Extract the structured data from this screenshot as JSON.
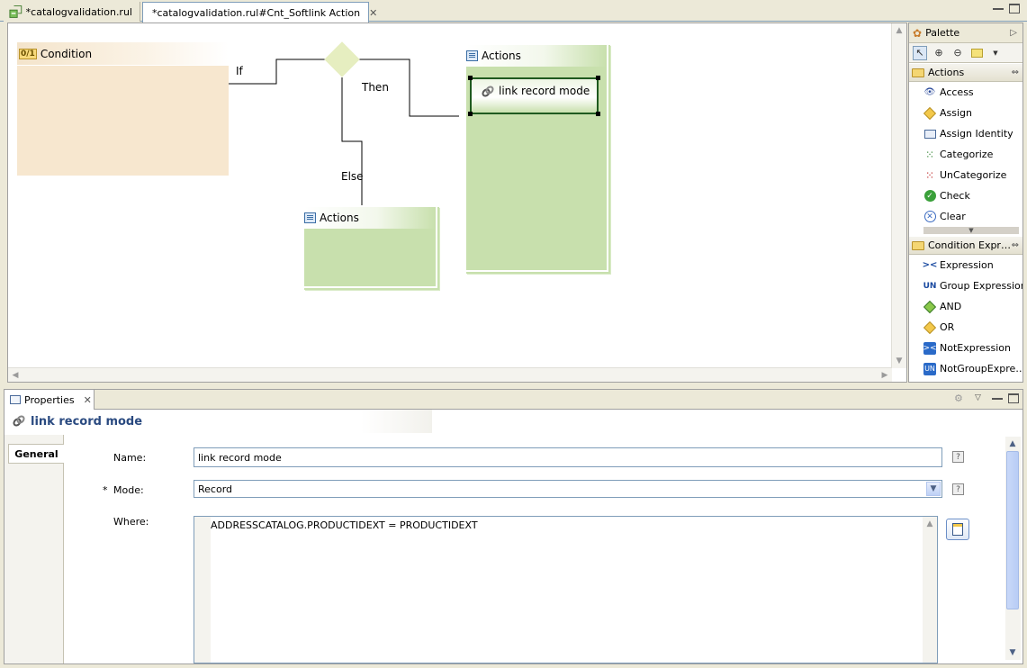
{
  "editor_tabs": [
    {
      "label": "*catalogvalidation.rul",
      "active": false
    },
    {
      "label": "*catalogvalidation.rul#Cnt_Softlink Action",
      "active": true
    }
  ],
  "diagram": {
    "condition_label": "Condition",
    "condition_icon_text": "0/1",
    "if_label": "If",
    "then_label": "Then",
    "else_label": "Else",
    "then_actions_label": "Actions",
    "else_actions_label": "Actions",
    "selected_node_label": "link record mode"
  },
  "palette": {
    "title": "Palette",
    "drawers": [
      {
        "label": "Actions",
        "items": [
          "Access",
          "Assign",
          "Assign Identity",
          "Categorize",
          "UnCategorize",
          "Check",
          "Clear"
        ]
      },
      {
        "label": "Condition Expr…",
        "items": [
          "Expression",
          "Group Expression",
          "AND",
          "OR",
          "NotExpression",
          "NotGroupExpre…"
        ]
      }
    ]
  },
  "properties": {
    "tab_label": "Properties",
    "title": "link record mode",
    "section_tab": "General",
    "name_label": "Name:",
    "name_value": "link record mode",
    "mode_required_marker": "*",
    "mode_label": "Mode:",
    "mode_value": "Record",
    "where_label": "Where:",
    "where_value": "ADDRESSCATALOG.PRODUCTIDEXT = PRODUCTIDEXT",
    "help_glyph": "?"
  },
  "colors": {
    "condition_fill": "#f7e7cf",
    "actions_fill": "#c8e0ad",
    "diamond_fill": "#e6eec0",
    "title_blue": "#2a4a80",
    "border_blue": "#7f9db9"
  }
}
